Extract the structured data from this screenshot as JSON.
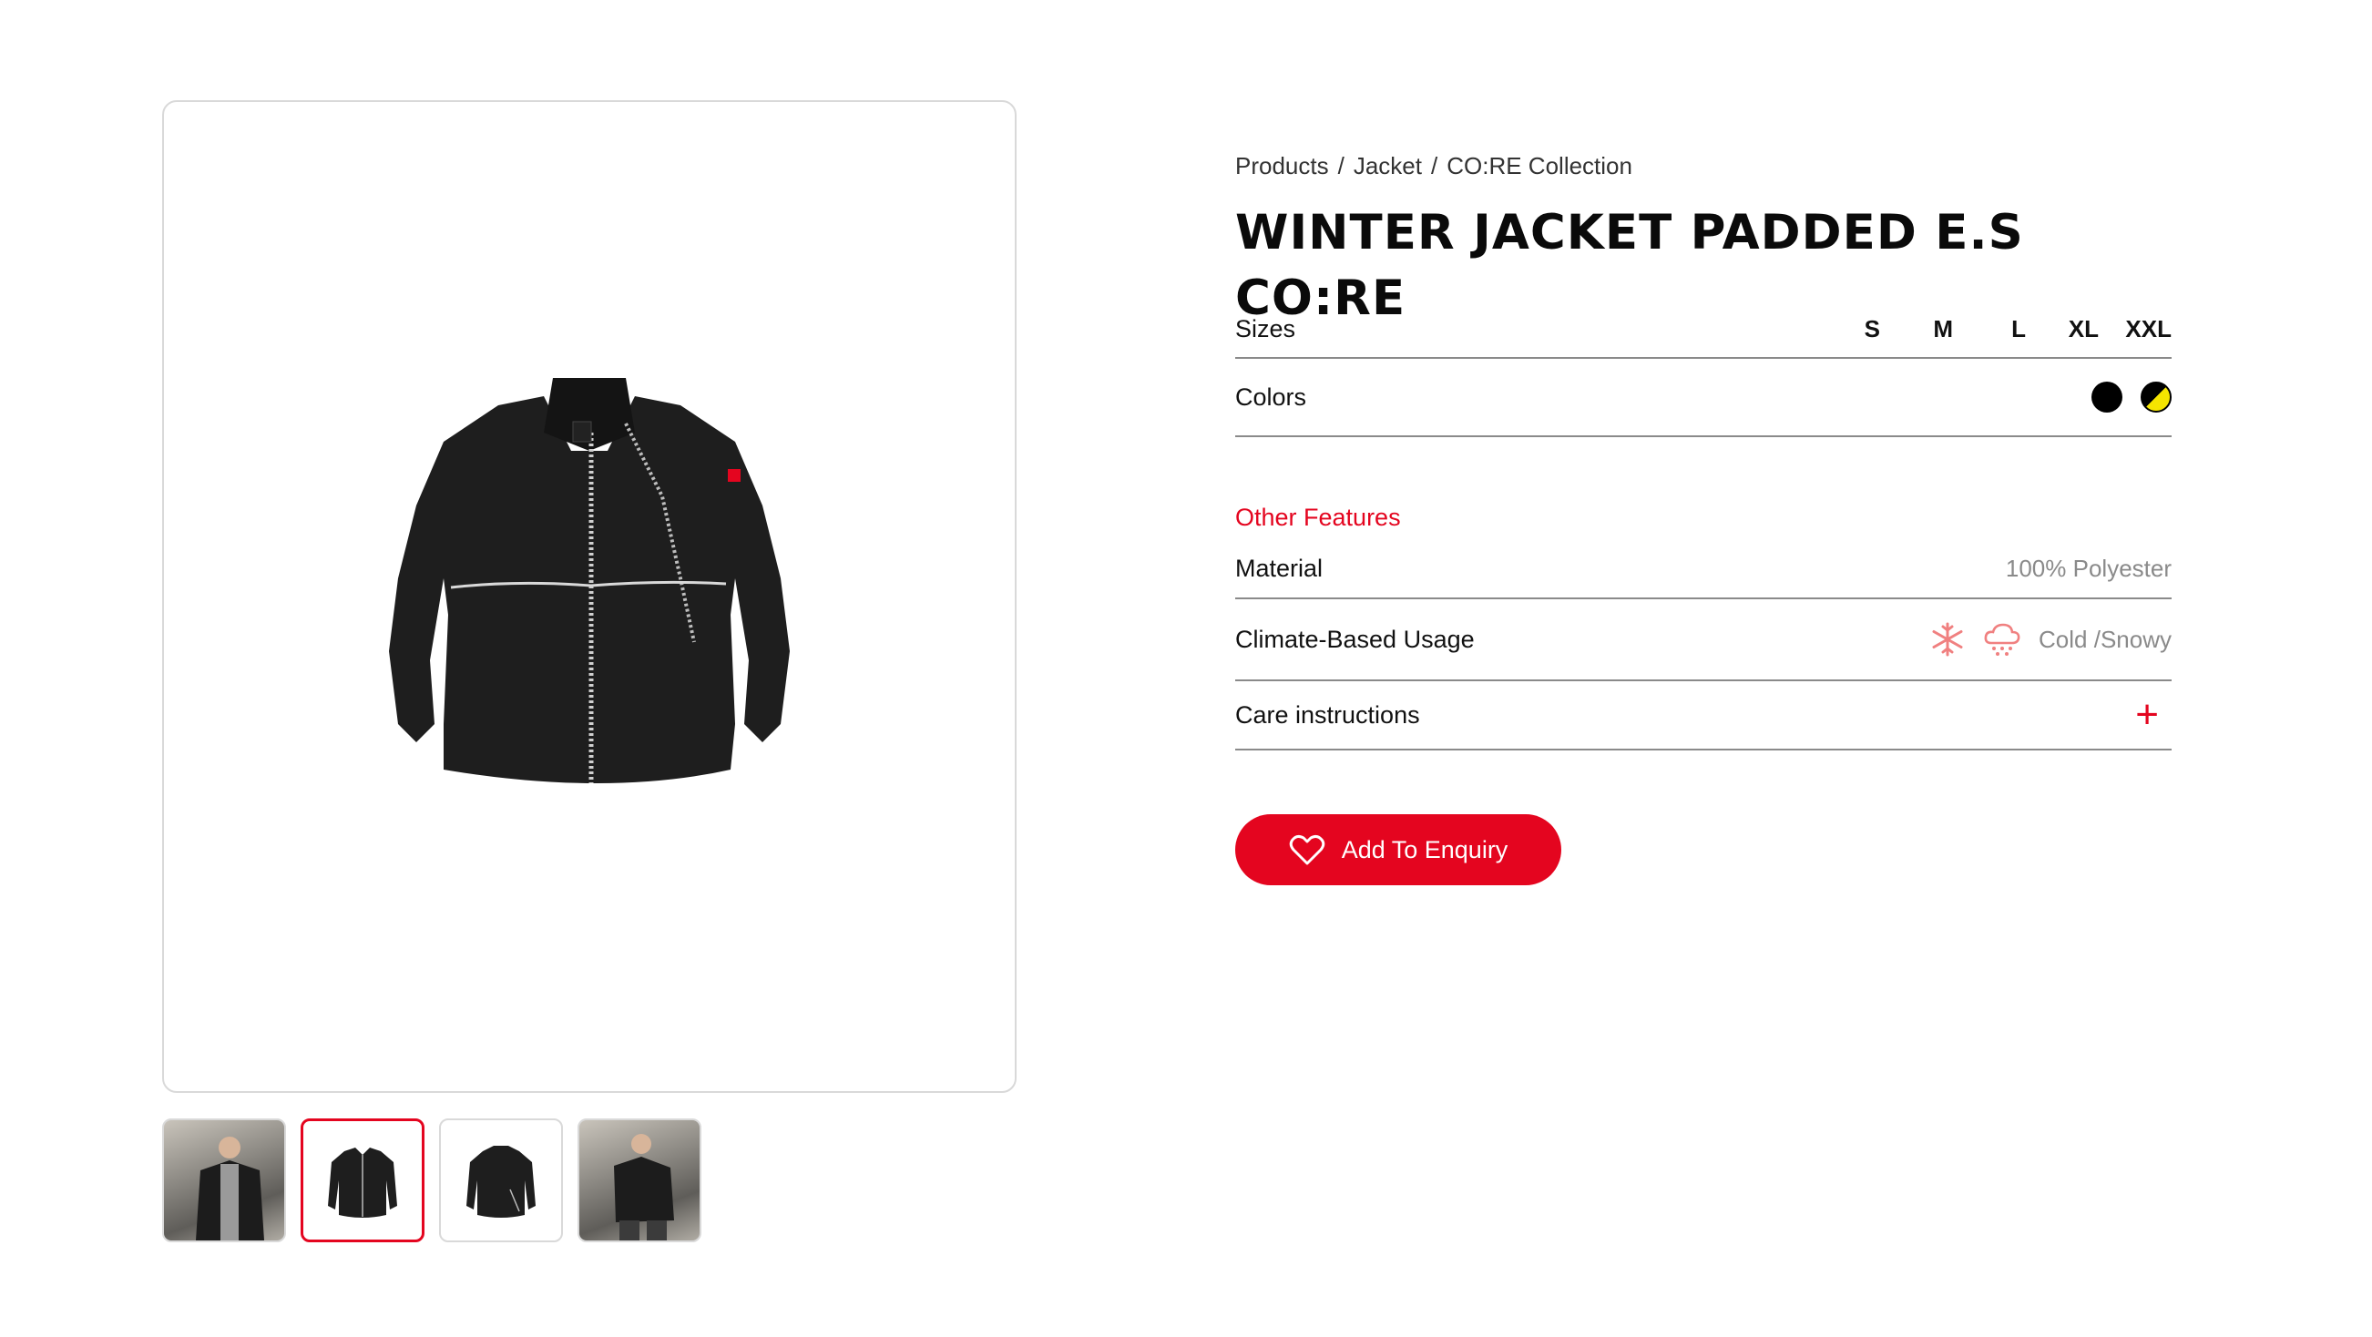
{
  "breadcrumb": {
    "items": [
      "Products",
      "Jacket",
      "CO:RE Collection"
    ],
    "separator": "/"
  },
  "product": {
    "title": "WINTER JACKET PADDED E.S CO:RE"
  },
  "sizes": {
    "label": "Sizes",
    "options": [
      "S",
      "M",
      "L",
      "XL",
      "XXL"
    ]
  },
  "colors": {
    "label": "Colors",
    "swatches": [
      {
        "name": "black-swatch",
        "hex": "#000000"
      },
      {
        "name": "black-yellow-swatch",
        "hex": "#f5e500"
      }
    ]
  },
  "features": {
    "heading": "Other Features",
    "material_label": "Material",
    "material_value": "100% Polyester",
    "climate_label": "Climate-Based Usage",
    "climate_value": "Cold /Snowy",
    "climate_icons": [
      "snowflake-icon",
      "snow-cloud-icon"
    ],
    "care_label": "Care instructions",
    "care_toggle": "+"
  },
  "cta": {
    "label": "Add To Enquiry",
    "icon": "heart-icon"
  },
  "gallery": {
    "active_index": 1,
    "thumbnails": [
      "model-front-photo",
      "jacket-front",
      "jacket-back",
      "model-side-photo"
    ]
  },
  "theme": {
    "accent": "#e4051f",
    "border": "#d9d9d9",
    "muted_text": "#8a8a8a"
  }
}
